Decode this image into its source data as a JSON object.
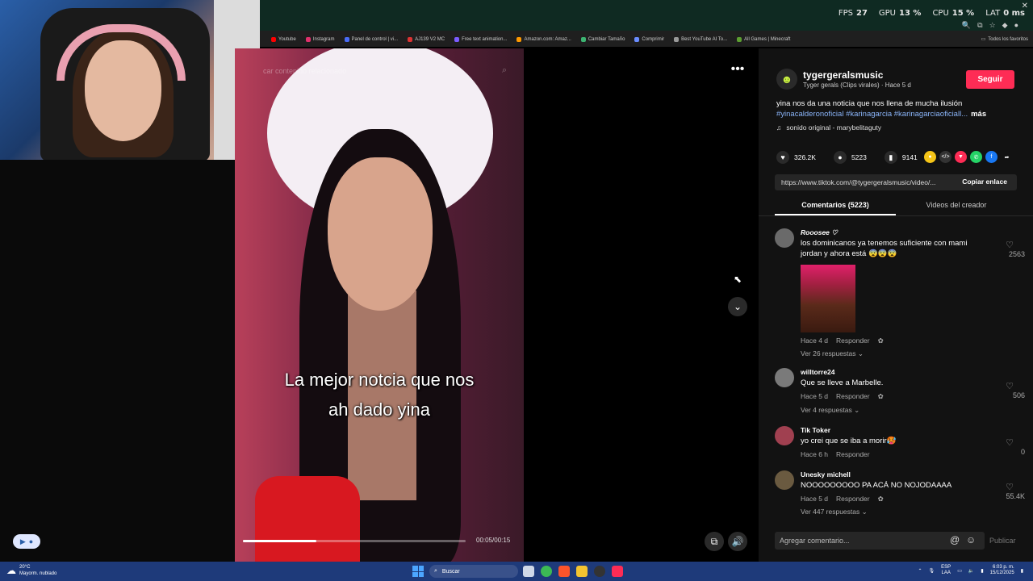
{
  "overlay_stats": [
    {
      "label": "FPS",
      "value": "27"
    },
    {
      "label": "GPU",
      "value": "13 %"
    },
    {
      "label": "CPU",
      "value": "15 %"
    },
    {
      "label": "LAT",
      "value": "0 ms"
    }
  ],
  "bookmarks": [
    {
      "label": "Youtube",
      "color": "#ff0000"
    },
    {
      "label": "Instagram",
      "color": "#e1306c"
    },
    {
      "label": "Panel de control | vi...",
      "color": "#4a6cf7"
    },
    {
      "label": "AJ139 V2 MC",
      "color": "#d33"
    },
    {
      "label": "Free text animation...",
      "color": "#7b5cff"
    },
    {
      "label": "Amazon.com: Amaz...",
      "color": "#f90"
    },
    {
      "label": "Cambiar Tamaño",
      "color": "#3cb371"
    },
    {
      "label": "Comprimir",
      "color": "#6a8cff"
    },
    {
      "label": "Best YouTube AI To...",
      "color": "#999"
    },
    {
      "label": "All Games | Minecraft",
      "color": "#5c9e31"
    }
  ],
  "bookmarks_all": "Todos los favoritos",
  "video": {
    "search_placeholder": "car contenido relacionado",
    "caption_line1": "La mejor notcia que nos",
    "caption_line2": "ah dado yina",
    "time": "00:05/00:15",
    "progress": 0.33
  },
  "post": {
    "username": "tygergeralsmusic",
    "subline": "Tyger gerals (Clips virales) · Hace 5 d",
    "follow_label": "Seguir",
    "description": "yina nos da una noticia que nos llena de mucha ilusión",
    "hashtags": "#yinacalderonoficial #karinagarcia #karinagarciaoficiall...",
    "more_label": "más",
    "sound": "sonido original - marybelitaguty",
    "likes": "326.2K",
    "comments_count": "5223",
    "saves": "9141",
    "url": "https://www.tiktok.com/@tygergeralsmusic/video/...",
    "copy_label": "Copiar enlace"
  },
  "tabs": {
    "comments": "Comentarios (5223)",
    "creator": "Videos del creador"
  },
  "comments": [
    {
      "name": "Rooosee",
      "text": "los dominicanos ya tenemos suficiente con mami jordan y ahora está 😨😨😨",
      "time": "Hace 4 d",
      "reply": "Responder",
      "likes": "2563",
      "replies": "Ver 26 respuestas"
    },
    {
      "name": "willtorre24",
      "text": "Que se lleve a Marbelle.",
      "time": "Hace 5 d",
      "reply": "Responder",
      "likes": "506",
      "replies": "Ver 4 respuestas"
    },
    {
      "name": "Tik Toker",
      "text": "yo crei que se iba a morir🥵",
      "time": "Hace 6 h",
      "reply": "Responder",
      "likes": "0",
      "replies": ""
    },
    {
      "name": "Unesky michell",
      "text": "NOOOOOOOOO PA ACÁ NO NOJODAAAA",
      "time": "Hace 5 d",
      "reply": "Responder",
      "likes": "55.4K",
      "replies": "Ver 447 respuestas"
    }
  ],
  "add_comment_placeholder": "Agregar comentario...",
  "publish_label": "Publicar",
  "taskbar": {
    "weather_temp": "20°C",
    "weather_desc": "Mayorm. nublado",
    "search_label": "Buscar",
    "lang1": "ESP",
    "lang2": "LAA",
    "time": "6:03 p. m.",
    "date": "15/12/2025"
  },
  "colors": {
    "accent": "#fe2c55",
    "hashtag": "#8ab4f8",
    "panel_bg": "#121212"
  }
}
